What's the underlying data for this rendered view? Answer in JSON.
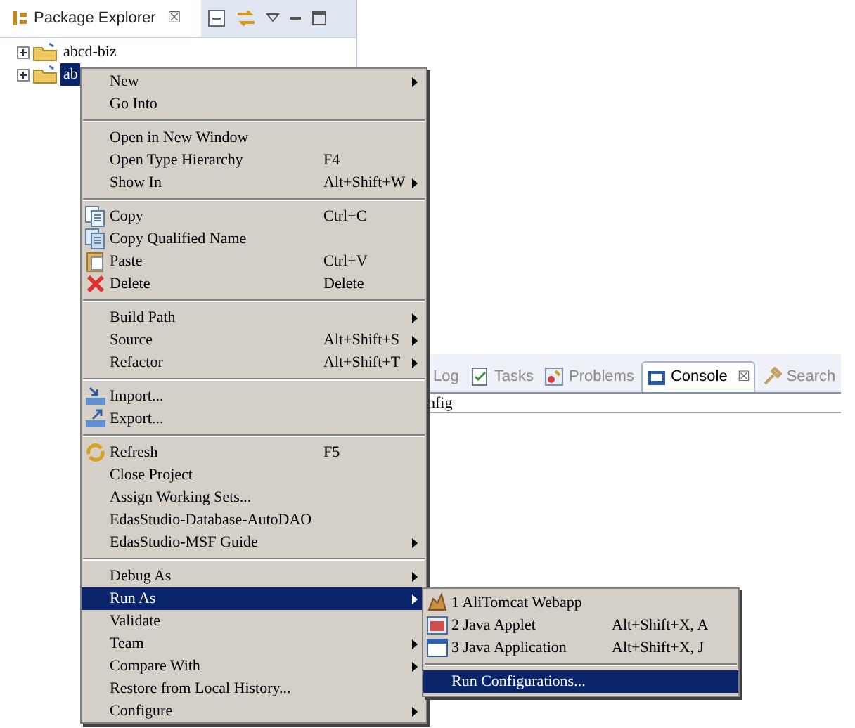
{
  "package_explorer": {
    "title": "Package Explorer",
    "close": "☒",
    "tree": [
      {
        "label": "abcd-biz",
        "selected": false
      },
      {
        "label": "ab",
        "selected": true
      }
    ]
  },
  "console_view": {
    "tabs": [
      {
        "label": "Log",
        "selected": false
      },
      {
        "label": "Tasks",
        "selected": false
      },
      {
        "label": "Problems",
        "selected": false
      },
      {
        "label": "Console",
        "selected": true,
        "close": "☒"
      },
      {
        "label": "Search",
        "selected": false
      }
    ],
    "text": "nfig"
  },
  "context_menu": {
    "items": [
      {
        "kind": "item",
        "label": "New",
        "submenu": true,
        "selected": false
      },
      {
        "kind": "item",
        "label": "Go Into",
        "submenu": false,
        "selected": false
      },
      {
        "kind": "separator"
      },
      {
        "kind": "item",
        "label": "Open in New Window",
        "submenu": false,
        "selected": false
      },
      {
        "kind": "item",
        "label": "Open Type Hierarchy",
        "shortcut": "F4",
        "submenu": false,
        "selected": false
      },
      {
        "kind": "item",
        "label": "Show In",
        "shortcut": "Alt+Shift+W",
        "submenu": true,
        "selected": false
      },
      {
        "kind": "separator"
      },
      {
        "kind": "item",
        "label": "Copy",
        "shortcut": "Ctrl+C",
        "icon": true,
        "submenu": false,
        "selected": false
      },
      {
        "kind": "item",
        "label": "Copy Qualified Name",
        "icon": true,
        "submenu": false,
        "selected": false
      },
      {
        "kind": "item",
        "label": "Paste",
        "shortcut": "Ctrl+V",
        "icon": true,
        "submenu": false,
        "selected": false
      },
      {
        "kind": "item",
        "label": "Delete",
        "shortcut": "Delete",
        "icon": true,
        "submenu": false,
        "selected": false
      },
      {
        "kind": "separator"
      },
      {
        "kind": "item",
        "label": "Build Path",
        "submenu": true,
        "selected": false
      },
      {
        "kind": "item",
        "label": "Source",
        "shortcut": "Alt+Shift+S",
        "submenu": true,
        "selected": false
      },
      {
        "kind": "item",
        "label": "Refactor",
        "shortcut": "Alt+Shift+T",
        "submenu": true,
        "selected": false
      },
      {
        "kind": "separator"
      },
      {
        "kind": "item",
        "label": "Import...",
        "icon": true,
        "submenu": false,
        "selected": false
      },
      {
        "kind": "item",
        "label": "Export...",
        "icon": true,
        "submenu": false,
        "selected": false
      },
      {
        "kind": "separator"
      },
      {
        "kind": "item",
        "label": "Refresh",
        "shortcut": "F5",
        "icon": true,
        "submenu": false,
        "selected": false
      },
      {
        "kind": "item",
        "label": "Close Project",
        "submenu": false,
        "selected": false
      },
      {
        "kind": "item",
        "label": "Assign Working Sets...",
        "submenu": false,
        "selected": false
      },
      {
        "kind": "item",
        "label": "EdasStudio-Database-AutoDAO",
        "submenu": false,
        "selected": false
      },
      {
        "kind": "item",
        "label": "EdasStudio-MSF Guide",
        "submenu": true,
        "selected": false
      },
      {
        "kind": "separator"
      },
      {
        "kind": "item",
        "label": "Debug As",
        "submenu": true,
        "selected": false
      },
      {
        "kind": "item",
        "label": "Run As",
        "submenu": true,
        "selected": true
      },
      {
        "kind": "item",
        "label": "Validate",
        "submenu": false,
        "selected": false
      },
      {
        "kind": "item",
        "label": "Team",
        "submenu": true,
        "selected": false
      },
      {
        "kind": "item",
        "label": "Compare With",
        "submenu": true,
        "selected": false
      },
      {
        "kind": "item",
        "label": "Restore from Local History...",
        "submenu": false,
        "selected": false
      },
      {
        "kind": "item",
        "label": "Configure",
        "submenu": true,
        "selected": false
      }
    ]
  },
  "run_as_submenu": {
    "items": [
      {
        "kind": "item",
        "label": "1 AliTomcat Webapp",
        "icon": true,
        "selected": false
      },
      {
        "kind": "item",
        "label": "2 Java Applet",
        "shortcut": "Alt+Shift+X, A",
        "icon": true,
        "selected": false
      },
      {
        "kind": "item",
        "label": "3 Java Application",
        "shortcut": "Alt+Shift+X, J",
        "icon": true,
        "selected": false
      },
      {
        "kind": "separator"
      },
      {
        "kind": "item",
        "label": "Run Configurations...",
        "selected": true
      }
    ]
  }
}
